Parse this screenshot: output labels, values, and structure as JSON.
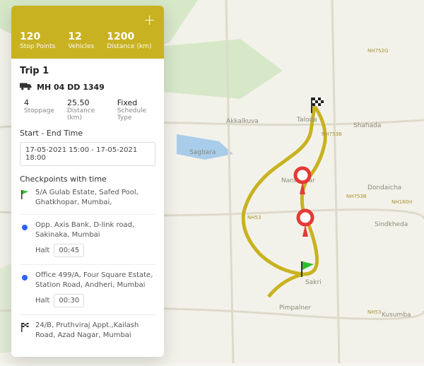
{
  "hero": {
    "stop_points_num": "120",
    "stop_points_lbl": "Stop Points",
    "vehicles_num": "12",
    "vehicles_lbl": "Vehicles",
    "distance_num": "1200",
    "distance_lbl": "Distance (km)"
  },
  "trip": {
    "title": "Trip 1",
    "vehicle": "MH 04 DD 1349",
    "stoppage_num": "4",
    "stoppage_lbl": "Stoppage",
    "distance_num": "25.50",
    "distance_lbl": "Distance (km)",
    "schedule_num": "Fixed",
    "schedule_lbl": "Schedule Type",
    "time_label": "Start - End Time",
    "time_range": "17-05-2021 15:00 - 17-05-2021 18:00",
    "checkpoints_label": "Checkpoints with time"
  },
  "checkpoints": [
    {
      "addr": "5/A Gulab Estate, Safed Pool, Ghatkhopar, Mumbai,"
    },
    {
      "addr": "Opp. Axis Bank, D-link road, Sakinaka, Mumbai",
      "halt_lbl": "Halt",
      "halt": "00:45"
    },
    {
      "addr": "Office 499/A, Four Square  Estate, Station Road, Andheri, Mumbai",
      "halt_lbl": "Halt",
      "halt": "00:30"
    },
    {
      "addr": "24/B, Pruthviraj Appt.,Kailash Road, Azad Nagar, Mumbai"
    }
  ],
  "map_labels": {
    "akkalkuva": "Akkalkuva",
    "taloda": "Taloda",
    "shahada": "Shahada",
    "nandurbar": "Nandurbar",
    "dondaicha": "Dondaicha",
    "sindkheda": "Sindkheda",
    "pimpalner": "Pimpalner",
    "sakri": "Sakri",
    "sagbara": "Sagbara",
    "kusumba": "Kusumba",
    "nh753b": "NH753B",
    "nh53": "NH53",
    "nh160h": "NH160H",
    "nh752g": "NH752G"
  }
}
